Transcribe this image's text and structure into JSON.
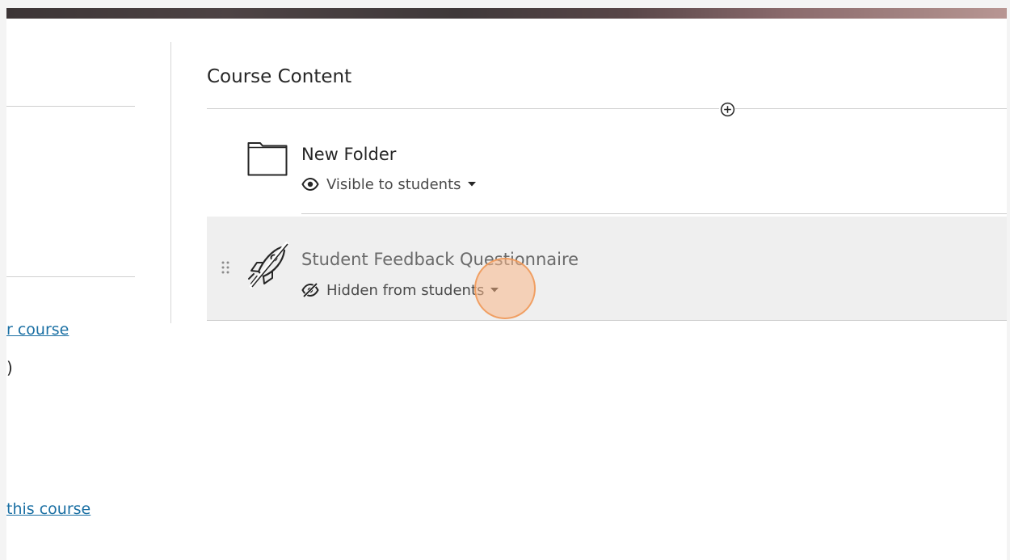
{
  "course_content": {
    "title": "Course Content"
  },
  "left_panel": {
    "link_1": "r course",
    "fragment": ")",
    "link_2": "this course"
  },
  "items": [
    {
      "type": "folder",
      "title": "New Folder",
      "visibility": "Visible to students",
      "icon": "folder-icon",
      "visibility_icon": "eye-icon"
    },
    {
      "type": "assessment",
      "title": "Student Feedback Questionnaire",
      "visibility": "Hidden from students",
      "icon": "rocket-icon",
      "visibility_icon": "eye-slash-icon"
    }
  ],
  "colors": {
    "link": "#1a6fa3",
    "highlight_row": "#efefef",
    "click_marker": "#f8b788"
  }
}
